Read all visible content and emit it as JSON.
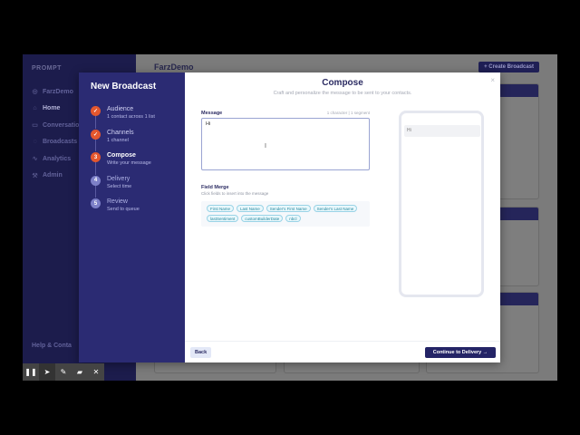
{
  "app": {
    "logo": "PROMPT",
    "nav": [
      {
        "label": "FarzDemo",
        "icon": "org-icon"
      },
      {
        "label": "Home",
        "icon": "home-icon"
      },
      {
        "label": "Conversations",
        "icon": "chat-icon"
      },
      {
        "label": "Broadcasts",
        "icon": "broadcast-icon"
      },
      {
        "label": "Analytics",
        "icon": "chart-icon"
      },
      {
        "label": "Admin",
        "icon": "wrench-icon"
      }
    ],
    "help_label": "Help & Conta",
    "page_title": "FarzDemo",
    "create_button": "+ Create Broadcast"
  },
  "wizard": {
    "title": "New Broadcast",
    "steps": [
      {
        "number": "1",
        "title": "Audience",
        "subtitle": "1 contact across 1 list",
        "state": "done"
      },
      {
        "number": "2",
        "title": "Channels",
        "subtitle": "1 channel",
        "state": "done"
      },
      {
        "number": "3",
        "title": "Compose",
        "subtitle": "Write your message",
        "state": "current"
      },
      {
        "number": "4",
        "title": "Delivery",
        "subtitle": "Select time",
        "state": "todo"
      },
      {
        "number": "5",
        "title": "Review",
        "subtitle": "Send to queue",
        "state": "todo"
      }
    ]
  },
  "compose": {
    "title": "Compose",
    "subtitle": "Craft and personalize the message to be sent to your contacts.",
    "message_label": "Message",
    "message_count": "1 character | 1 segment",
    "message_value": "Hi",
    "field_merge_label": "Field Merge",
    "field_merge_sub": "Click fields to insert into the message",
    "fields": [
      "First Name",
      "Last Name",
      "Sender's First Name",
      "Sender's Last Name",
      "lastSentiment",
      "customBuilderDate",
      "nbcl"
    ],
    "preview_text": "Hi"
  },
  "footer": {
    "back": "Back",
    "continue": "Continue to Delivery →"
  },
  "toolbar": {
    "pause": "❚❚",
    "select": "➤",
    "pen": "✎",
    "eraser": "▰",
    "close": "✕"
  },
  "close_glyph": "×",
  "check_glyph": "✓"
}
